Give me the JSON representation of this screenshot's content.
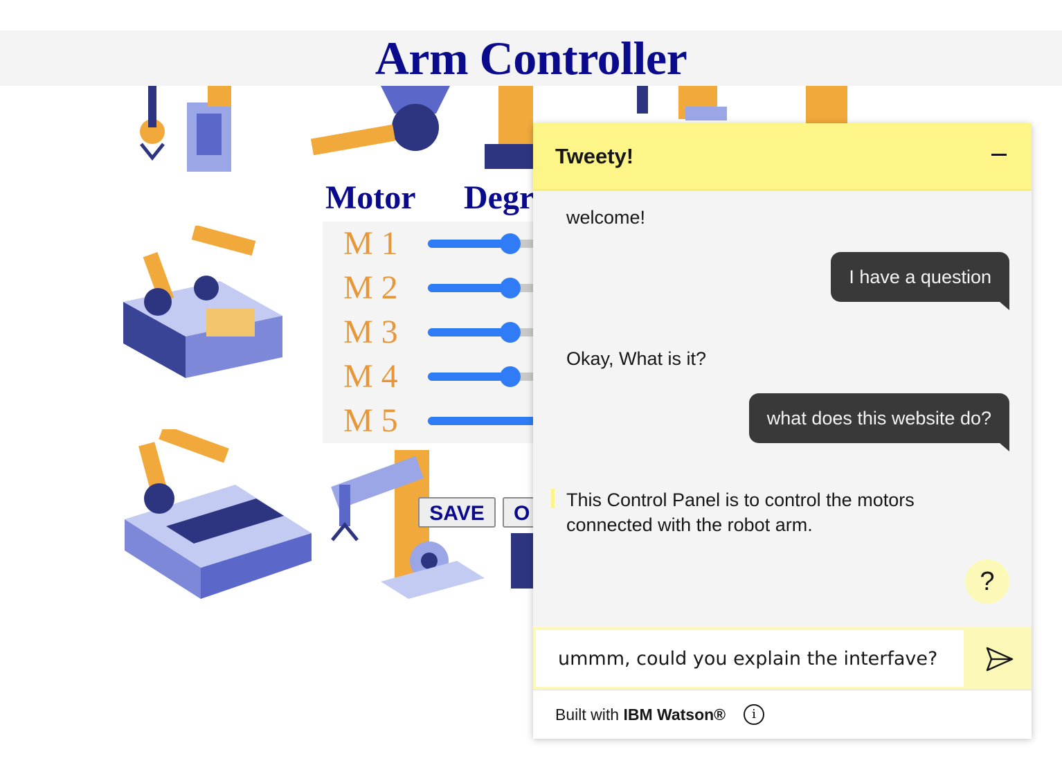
{
  "header": {
    "title": "Arm Controller"
  },
  "panel": {
    "motor_heading": "Motor",
    "degree_heading": "Degr",
    "motors": [
      {
        "label": "M 1",
        "value": 0.7
      },
      {
        "label": "M 2",
        "value": 0.7
      },
      {
        "label": "M 3",
        "value": 0.7
      },
      {
        "label": "M 4",
        "value": 0.7
      },
      {
        "label": "M 5",
        "value": 1.0
      }
    ],
    "save_label": "SAVE",
    "second_button_label": "O"
  },
  "colors": {
    "title": "#0a0a8c",
    "motor_label": "#e8963a",
    "slider": "#2f7cf6",
    "chat_header": "#fdf587",
    "user_bubble": "#393939"
  },
  "chat": {
    "title": "Tweety!",
    "messages": [
      {
        "from": "bot",
        "text": "welcome!"
      },
      {
        "from": "user",
        "text": "I have a question"
      },
      {
        "from": "bot",
        "text": "Okay, What is it?"
      },
      {
        "from": "user",
        "text": "what does this website do?"
      },
      {
        "from": "bot",
        "text": "This Control Panel is to control the motors connected with the robot arm."
      }
    ],
    "help_label": "?",
    "input_value": "ummm, could you explain the interfave?",
    "footer_prefix": "Built with ",
    "footer_brand": "IBM Watson®",
    "info_label": "i",
    "icons": {
      "minimize": "minimize-icon",
      "send": "send-icon",
      "info": "info-icon",
      "help": "help-icon"
    }
  }
}
